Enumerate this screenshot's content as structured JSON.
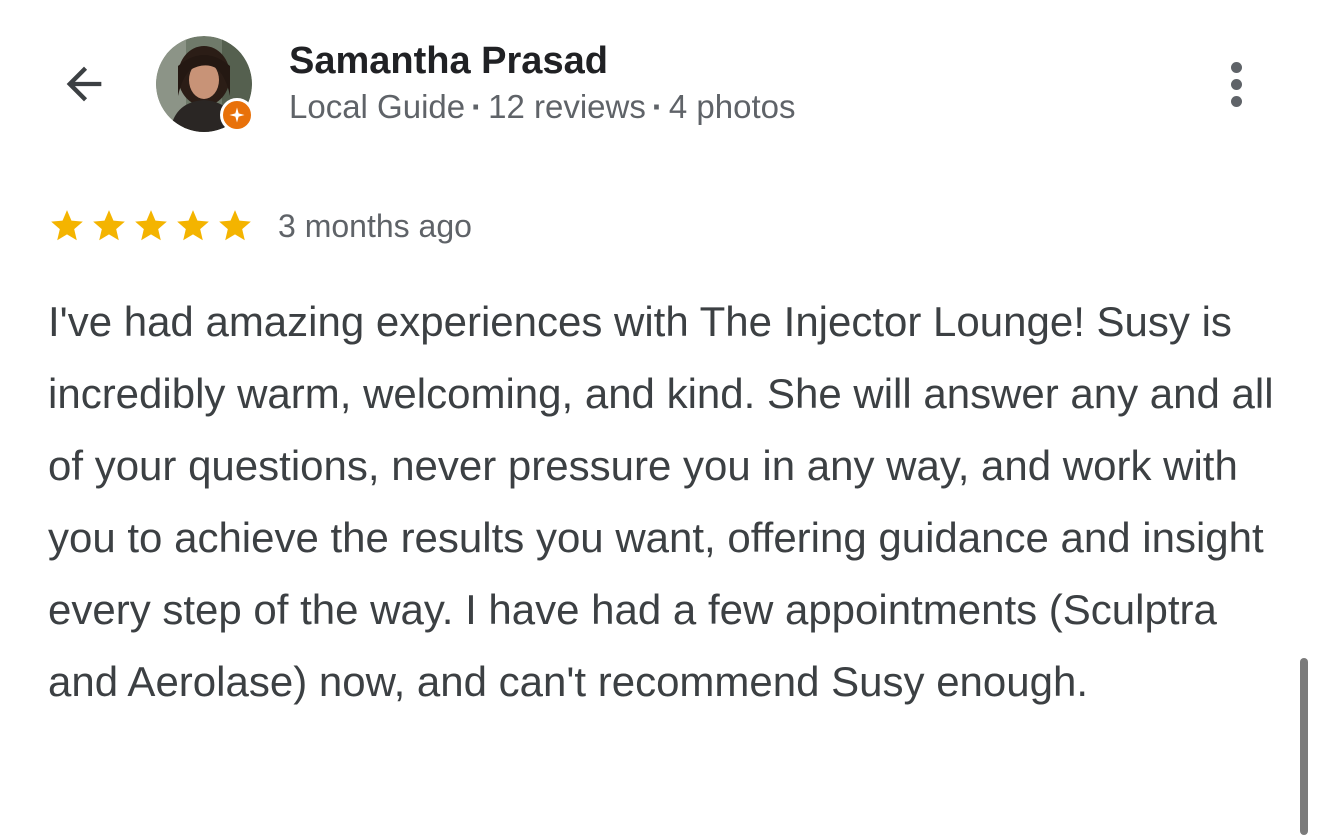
{
  "reviewer": {
    "name": "Samantha Prasad",
    "badge": "Local Guide",
    "reviews": "12 reviews",
    "photos": "4 photos",
    "separator": "·"
  },
  "review": {
    "stars": 5,
    "max_stars": 5,
    "date": "3 months ago",
    "text": "I've had amazing experiences with The Injector Lounge! Susy is incredibly warm, welcoming, and kind. She will answer any and all of your questions, never pressure you in any way, and work with you to achieve the results you want, offering guidance and insight every step of the way. I have had a few appointments (Sculptra and Aerolase) now, and can't recommend Susy enough."
  },
  "icons": {
    "back": "arrow-back-icon",
    "more": "more-vert-icon",
    "star": "star-icon",
    "local_guide": "local-guide-badge-icon"
  },
  "colors": {
    "star": "#f4b400",
    "badge": "#e8710a",
    "name": "#202124",
    "meta": "#5f6368",
    "body_text": "#3c4043"
  }
}
